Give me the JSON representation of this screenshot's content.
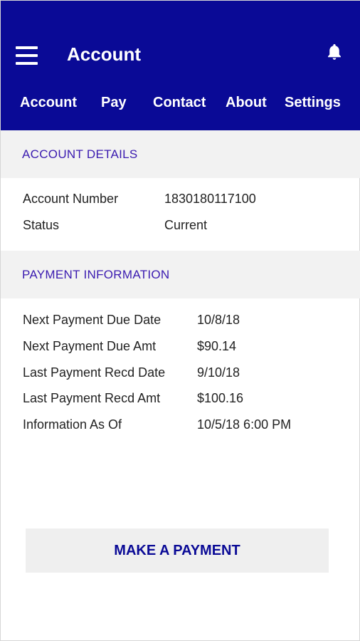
{
  "header": {
    "title": "Account",
    "menu_icon": "hamburger-menu-icon",
    "notification_icon": "bell-icon",
    "background_color": "#0a0a96"
  },
  "tabs": [
    {
      "label": "Account",
      "selected": true
    },
    {
      "label": "Pay",
      "selected": false
    },
    {
      "label": "Contact",
      "selected": false
    },
    {
      "label": "About",
      "selected": false
    },
    {
      "label": "Settings",
      "selected": false
    }
  ],
  "account_details": {
    "title": "ACCOUNT DETAILS",
    "rows": [
      {
        "label": "Account Number",
        "value": "1830180117100"
      },
      {
        "label": "Status",
        "value": "Current"
      }
    ]
  },
  "payment_information": {
    "title": "PAYMENT INFORMATION",
    "rows": [
      {
        "label": "Next Payment Due Date",
        "value": "10/8/18"
      },
      {
        "label": "Next Payment Due Amt",
        "value": "$90.14"
      },
      {
        "label": "Last Payment Recd Date",
        "value": "9/10/18"
      },
      {
        "label": "Last Payment Recd Amt",
        "value": "$100.16"
      },
      {
        "label": "Information As Of",
        "value": "10/5/18 6:00 PM"
      }
    ]
  },
  "actions": {
    "make_payment_label": "MAKE A PAYMENT"
  }
}
